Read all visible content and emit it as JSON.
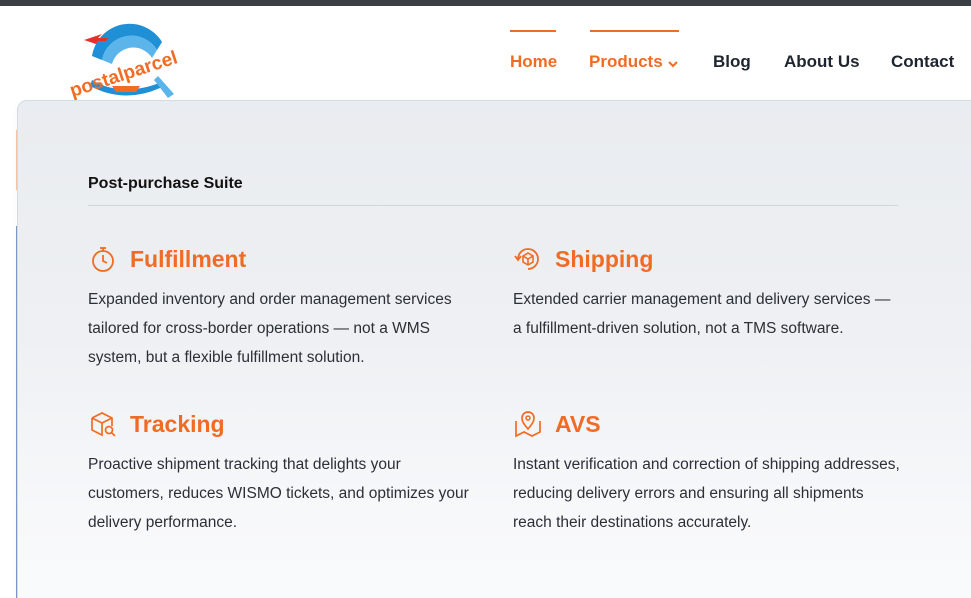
{
  "brand": {
    "name": "postalparcel",
    "accent": "#f26b24",
    "dark": "#3a3f45"
  },
  "nav": {
    "home": "Home",
    "products": "Products",
    "blog": "Blog",
    "about": "About Us",
    "contact": "Contact"
  },
  "menu": {
    "title": "Post-purchase Suite",
    "items": [
      {
        "title": "Fulfillment",
        "icon": "stopwatch-icon",
        "desc": "Expanded inventory and order management services tailored for cross-border operations — not a WMS system, but a flexible fulfillment solution."
      },
      {
        "title": "Shipping",
        "icon": "box-cycle-icon",
        "desc": "Extended carrier management and delivery services — a fulfillment-driven solution, not a TMS software."
      },
      {
        "title": "Tracking",
        "icon": "box-search-icon",
        "desc": "Proactive shipment tracking that delights your customers, reduces WISMO tickets, and optimizes your delivery performance."
      },
      {
        "title": "AVS",
        "icon": "map-pin-icon",
        "desc": "Instant verification and correction of shipping addresses, reducing delivery errors and ensuring all shipments reach their destinations accurately."
      }
    ]
  }
}
